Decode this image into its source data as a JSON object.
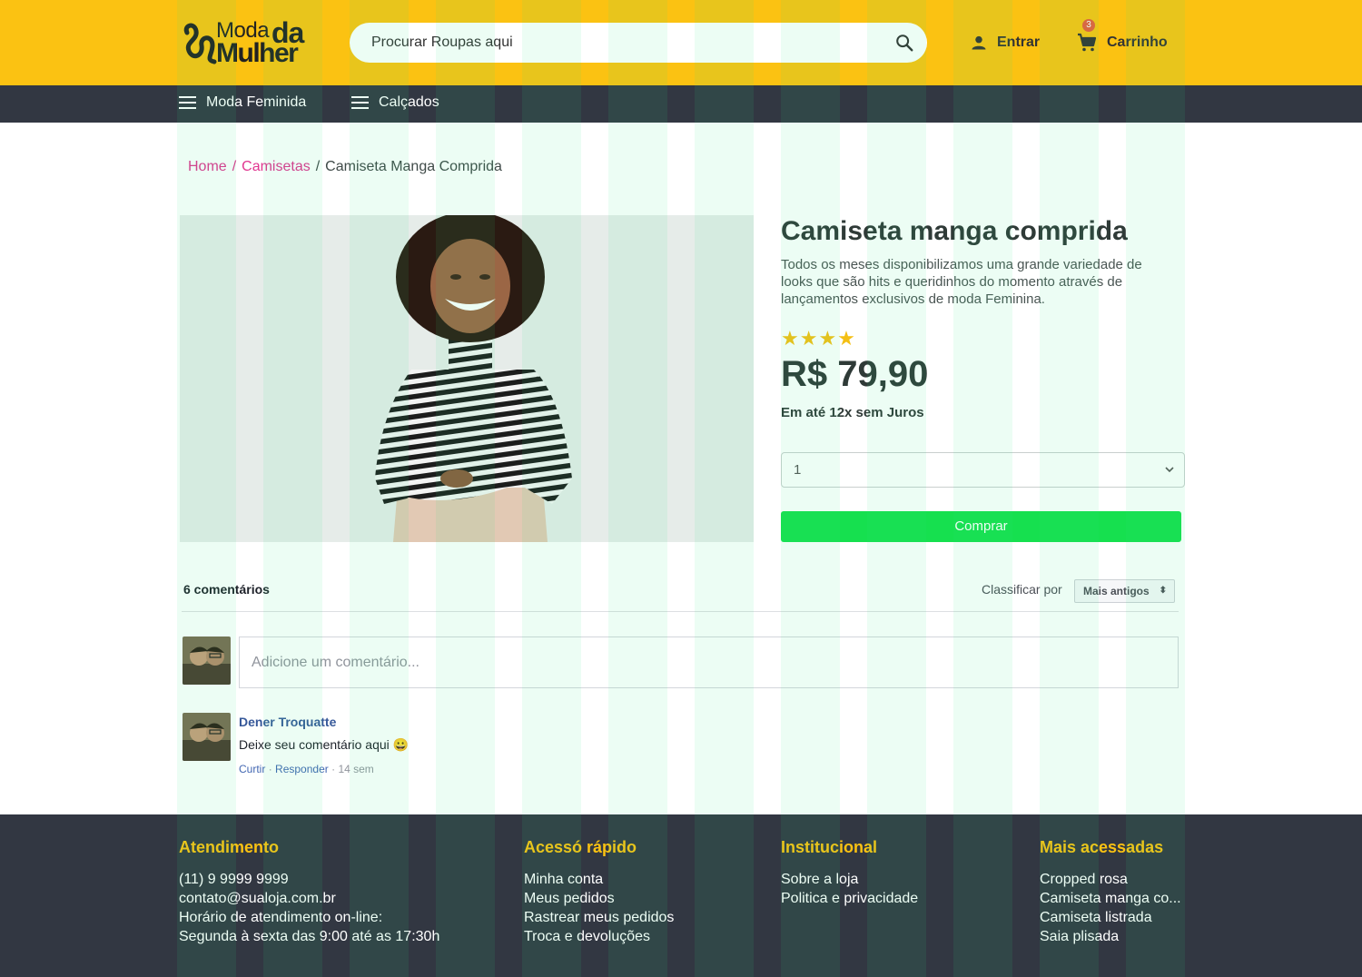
{
  "brand": {
    "logo_moda": "Moda",
    "logo_da": "da",
    "logo_mulher": "Mulher",
    "yellow": "#fbc212",
    "dark": "#323742",
    "pink": "#e0358f",
    "green": "#16e04f"
  },
  "header": {
    "search_placeholder": "Procurar Roupas aqui",
    "login_label": "Entrar",
    "cart_label": "Carrinho",
    "cart_count": "3"
  },
  "nav": {
    "items": [
      {
        "label": "Moda Feminida",
        "icon": "menu-icon"
      },
      {
        "label": "Calçados",
        "icon": "menu-icon"
      }
    ]
  },
  "breadcrumb": {
    "home": "Home",
    "category": "Camisetas",
    "current": "Camiseta Manga Comprida",
    "separator": "/"
  },
  "product": {
    "title": "Camiseta manga comprida",
    "description": "Todos os meses disponibilizamos uma grande variedade de looks que são hits e queridinhos do momento através de lançamentos exclusivos de moda Feminina.",
    "stars": "★★★★",
    "rating": 4,
    "price": "R$ 79,90",
    "installments": "Em até 12x sem Juros",
    "quantity": "1",
    "buy_label": "Comprar"
  },
  "comments": {
    "count_label": "6 comentários",
    "sort_label": "Classificar por",
    "sort_value": "Mais antigos",
    "input_placeholder": "Adicione um comentário...",
    "items": [
      {
        "author": "Dener Troquatte",
        "text": "Deixe seu comentário aqui 😀",
        "like": "Curtir",
        "reply": "Responder",
        "time": "14 sem"
      }
    ]
  },
  "footer": {
    "columns": [
      {
        "title": "Atendimento",
        "lines": [
          "(11) 9 9999 9999",
          "contato@sualoja.com.br",
          "Horário de atendimento on-line:",
          "Segunda à sexta das 9:00 até as 17:30h"
        ]
      },
      {
        "title": "Acessó rápido",
        "lines": [
          "Minha conta",
          "Meus pedidos",
          "Rastrear meus pedidos",
          "Troca e devoluções"
        ]
      },
      {
        "title": "Institucional",
        "lines": [
          "Sobre a loja",
          "Politica e privacidade"
        ]
      },
      {
        "title": "Mais acessadas",
        "lines": [
          "Cropped rosa",
          "Camiseta manga co...",
          "Camiseta listrada",
          "Saia plisada"
        ]
      }
    ]
  }
}
